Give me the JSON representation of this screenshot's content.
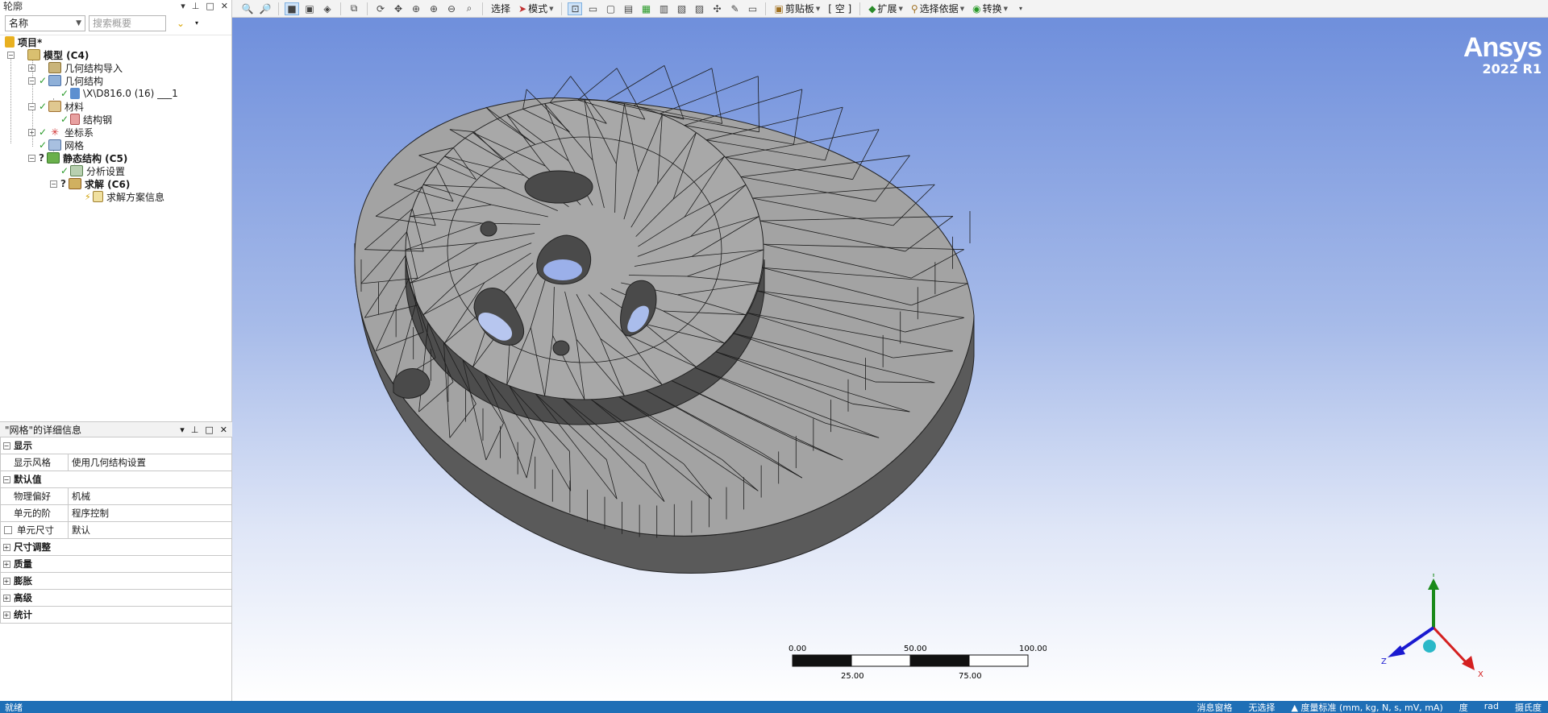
{
  "outline": {
    "title": "轮廓",
    "name_select": "名称",
    "search_placeholder": "搜索概要",
    "tree": [
      {
        "label": "项目*",
        "bold": true
      },
      {
        "label": "模型 (C4)",
        "bold": true
      },
      {
        "label": "几何结构导入"
      },
      {
        "label": "几何结构"
      },
      {
        "label": "\\X\\D816.0 (16) ___1"
      },
      {
        "label": "材料"
      },
      {
        "label": "结构钢"
      },
      {
        "label": "坐标系"
      },
      {
        "label": "网格"
      },
      {
        "label": "静态结构 (C5)",
        "bold": true
      },
      {
        "label": "分析设置"
      },
      {
        "label": "求解 (C6)",
        "bold": true
      },
      {
        "label": "求解方案信息"
      }
    ]
  },
  "details": {
    "title": "\"网格\"的详细信息",
    "rows": [
      {
        "type": "group",
        "label": "显示",
        "expanded": true
      },
      {
        "type": "prop",
        "key": "显示风格",
        "value": "使用几何结构设置"
      },
      {
        "type": "group",
        "label": "默认值",
        "expanded": true
      },
      {
        "type": "prop",
        "key": "物理偏好",
        "value": "机械"
      },
      {
        "type": "prop",
        "key": "单元的阶",
        "value": "程序控制"
      },
      {
        "type": "prop",
        "key": "单元尺寸",
        "value": "默认",
        "checkbox": true
      },
      {
        "type": "group",
        "label": "尺寸调整",
        "expanded": false
      },
      {
        "type": "group",
        "label": "质量",
        "expanded": false
      },
      {
        "type": "group",
        "label": "膨胀",
        "expanded": false
      },
      {
        "type": "group",
        "label": "高级",
        "expanded": false
      },
      {
        "type": "group",
        "label": "统计",
        "expanded": false
      }
    ]
  },
  "toolbar": {
    "select": "选择",
    "mode": "模式",
    "clipboard": "剪贴板",
    "empty": "[ 空 ]",
    "extend": "扩展",
    "select_by": "选择依据",
    "convert": "转换"
  },
  "viewport": {
    "brand": "Ansys",
    "version": "2022 R1",
    "scale": {
      "labels_top": [
        "0.00",
        "50.00",
        "100.00 (mm)"
      ],
      "labels_bottom": [
        "25.00",
        "75.00"
      ]
    },
    "axes": {
      "x": "X",
      "y": "Y",
      "z": "Z"
    },
    "colors": {
      "bg_top": "#6f8fdc",
      "bg_bottom": "#ffffff",
      "mesh_face": "#a3a3a3",
      "mesh_side": "#5a5a5a",
      "axis_x": "#d42020",
      "axis_y": "#1a8a1a",
      "axis_z": "#1a1ad0"
    }
  },
  "status": {
    "left": "就绪",
    "messages": "消息窗格",
    "selection": "无选择",
    "units": "▲ 度量标准 (mm, kg, N, s, mV, mA)",
    "deg": "度",
    "rad": "rad",
    "celsius": "摄氏度"
  }
}
